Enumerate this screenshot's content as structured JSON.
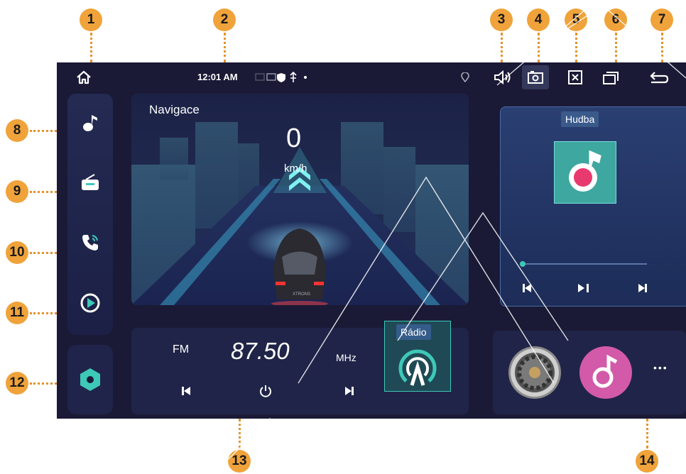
{
  "callouts": [
    "1",
    "2",
    "3",
    "4",
    "5",
    "6",
    "7",
    "8",
    "9",
    "10",
    "11",
    "12",
    "13",
    "14"
  ],
  "statusbar": {
    "time": "12:01 AM"
  },
  "nav": {
    "title": "Navigace",
    "speed": "0",
    "unit": "km/h",
    "car_brand": "XTRONS"
  },
  "music": {
    "title": "Hudba",
    "progress": 0.0
  },
  "radio": {
    "band": "FM",
    "frequency": "87.50",
    "unit": "MHz",
    "title": "Rádio"
  },
  "apps": {
    "more": "•••"
  },
  "colors": {
    "accent_orange": "#f0a33a",
    "screen_bg": "#1a1a36",
    "music_pink": "#e83a6e",
    "teal": "#3ec8b8"
  },
  "icons": [
    "home-icon",
    "volume-icon",
    "screenshot-icon",
    "close-app-icon",
    "multitask-icon",
    "back-icon",
    "music-note-icon",
    "radio-icon",
    "phone-icon",
    "play-circle-icon",
    "hexagon-icon",
    "settings-gear-icon",
    "power-icon",
    "prev-icon",
    "next-icon",
    "play-pause-icon",
    "location-icon"
  ]
}
